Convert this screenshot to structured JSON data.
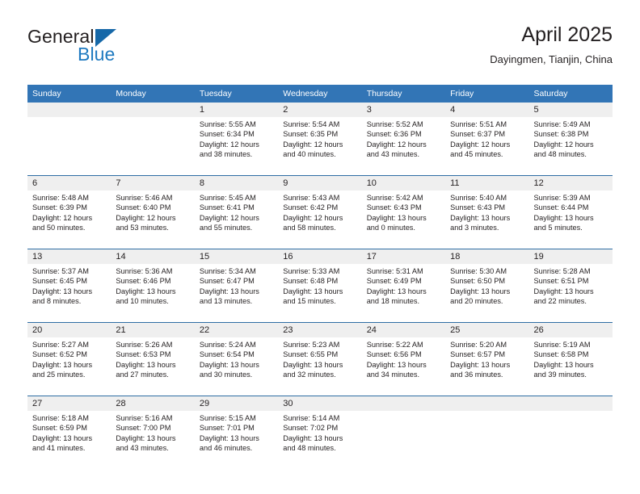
{
  "brand": {
    "name_part1": "General",
    "name_part2": "Blue",
    "triangle_color": "#1668a8",
    "blue_text_color": "#1f7ac0"
  },
  "header": {
    "title": "April 2025",
    "subtitle": "Dayingmen, Tianjin, China"
  },
  "theme": {
    "header_blue": "#3275b6",
    "row_divider_blue": "#2e6da4",
    "daynum_band": "#efefef",
    "text": "#231f20"
  },
  "weekday_headers": [
    "Sunday",
    "Monday",
    "Tuesday",
    "Wednesday",
    "Thursday",
    "Friday",
    "Saturday"
  ],
  "weeks": [
    [
      {
        "empty": true
      },
      {
        "empty": true
      },
      {
        "day": "1",
        "sunrise": "Sunrise: 5:55 AM",
        "sunset": "Sunset: 6:34 PM",
        "daylight_line1": "Daylight: 12 hours",
        "daylight_line2": "and 38 minutes."
      },
      {
        "day": "2",
        "sunrise": "Sunrise: 5:54 AM",
        "sunset": "Sunset: 6:35 PM",
        "daylight_line1": "Daylight: 12 hours",
        "daylight_line2": "and 40 minutes."
      },
      {
        "day": "3",
        "sunrise": "Sunrise: 5:52 AM",
        "sunset": "Sunset: 6:36 PM",
        "daylight_line1": "Daylight: 12 hours",
        "daylight_line2": "and 43 minutes."
      },
      {
        "day": "4",
        "sunrise": "Sunrise: 5:51 AM",
        "sunset": "Sunset: 6:37 PM",
        "daylight_line1": "Daylight: 12 hours",
        "daylight_line2": "and 45 minutes."
      },
      {
        "day": "5",
        "sunrise": "Sunrise: 5:49 AM",
        "sunset": "Sunset: 6:38 PM",
        "daylight_line1": "Daylight: 12 hours",
        "daylight_line2": "and 48 minutes."
      }
    ],
    [
      {
        "day": "6",
        "sunrise": "Sunrise: 5:48 AM",
        "sunset": "Sunset: 6:39 PM",
        "daylight_line1": "Daylight: 12 hours",
        "daylight_line2": "and 50 minutes."
      },
      {
        "day": "7",
        "sunrise": "Sunrise: 5:46 AM",
        "sunset": "Sunset: 6:40 PM",
        "daylight_line1": "Daylight: 12 hours",
        "daylight_line2": "and 53 minutes."
      },
      {
        "day": "8",
        "sunrise": "Sunrise: 5:45 AM",
        "sunset": "Sunset: 6:41 PM",
        "daylight_line1": "Daylight: 12 hours",
        "daylight_line2": "and 55 minutes."
      },
      {
        "day": "9",
        "sunrise": "Sunrise: 5:43 AM",
        "sunset": "Sunset: 6:42 PM",
        "daylight_line1": "Daylight: 12 hours",
        "daylight_line2": "and 58 minutes."
      },
      {
        "day": "10",
        "sunrise": "Sunrise: 5:42 AM",
        "sunset": "Sunset: 6:43 PM",
        "daylight_line1": "Daylight: 13 hours",
        "daylight_line2": "and 0 minutes."
      },
      {
        "day": "11",
        "sunrise": "Sunrise: 5:40 AM",
        "sunset": "Sunset: 6:43 PM",
        "daylight_line1": "Daylight: 13 hours",
        "daylight_line2": "and 3 minutes."
      },
      {
        "day": "12",
        "sunrise": "Sunrise: 5:39 AM",
        "sunset": "Sunset: 6:44 PM",
        "daylight_line1": "Daylight: 13 hours",
        "daylight_line2": "and 5 minutes."
      }
    ],
    [
      {
        "day": "13",
        "sunrise": "Sunrise: 5:37 AM",
        "sunset": "Sunset: 6:45 PM",
        "daylight_line1": "Daylight: 13 hours",
        "daylight_line2": "and 8 minutes."
      },
      {
        "day": "14",
        "sunrise": "Sunrise: 5:36 AM",
        "sunset": "Sunset: 6:46 PM",
        "daylight_line1": "Daylight: 13 hours",
        "daylight_line2": "and 10 minutes."
      },
      {
        "day": "15",
        "sunrise": "Sunrise: 5:34 AM",
        "sunset": "Sunset: 6:47 PM",
        "daylight_line1": "Daylight: 13 hours",
        "daylight_line2": "and 13 minutes."
      },
      {
        "day": "16",
        "sunrise": "Sunrise: 5:33 AM",
        "sunset": "Sunset: 6:48 PM",
        "daylight_line1": "Daylight: 13 hours",
        "daylight_line2": "and 15 minutes."
      },
      {
        "day": "17",
        "sunrise": "Sunrise: 5:31 AM",
        "sunset": "Sunset: 6:49 PM",
        "daylight_line1": "Daylight: 13 hours",
        "daylight_line2": "and 18 minutes."
      },
      {
        "day": "18",
        "sunrise": "Sunrise: 5:30 AM",
        "sunset": "Sunset: 6:50 PM",
        "daylight_line1": "Daylight: 13 hours",
        "daylight_line2": "and 20 minutes."
      },
      {
        "day": "19",
        "sunrise": "Sunrise: 5:28 AM",
        "sunset": "Sunset: 6:51 PM",
        "daylight_line1": "Daylight: 13 hours",
        "daylight_line2": "and 22 minutes."
      }
    ],
    [
      {
        "day": "20",
        "sunrise": "Sunrise: 5:27 AM",
        "sunset": "Sunset: 6:52 PM",
        "daylight_line1": "Daylight: 13 hours",
        "daylight_line2": "and 25 minutes."
      },
      {
        "day": "21",
        "sunrise": "Sunrise: 5:26 AM",
        "sunset": "Sunset: 6:53 PM",
        "daylight_line1": "Daylight: 13 hours",
        "daylight_line2": "and 27 minutes."
      },
      {
        "day": "22",
        "sunrise": "Sunrise: 5:24 AM",
        "sunset": "Sunset: 6:54 PM",
        "daylight_line1": "Daylight: 13 hours",
        "daylight_line2": "and 30 minutes."
      },
      {
        "day": "23",
        "sunrise": "Sunrise: 5:23 AM",
        "sunset": "Sunset: 6:55 PM",
        "daylight_line1": "Daylight: 13 hours",
        "daylight_line2": "and 32 minutes."
      },
      {
        "day": "24",
        "sunrise": "Sunrise: 5:22 AM",
        "sunset": "Sunset: 6:56 PM",
        "daylight_line1": "Daylight: 13 hours",
        "daylight_line2": "and 34 minutes."
      },
      {
        "day": "25",
        "sunrise": "Sunrise: 5:20 AM",
        "sunset": "Sunset: 6:57 PM",
        "daylight_line1": "Daylight: 13 hours",
        "daylight_line2": "and 36 minutes."
      },
      {
        "day": "26",
        "sunrise": "Sunrise: 5:19 AM",
        "sunset": "Sunset: 6:58 PM",
        "daylight_line1": "Daylight: 13 hours",
        "daylight_line2": "and 39 minutes."
      }
    ],
    [
      {
        "day": "27",
        "sunrise": "Sunrise: 5:18 AM",
        "sunset": "Sunset: 6:59 PM",
        "daylight_line1": "Daylight: 13 hours",
        "daylight_line2": "and 41 minutes."
      },
      {
        "day": "28",
        "sunrise": "Sunrise: 5:16 AM",
        "sunset": "Sunset: 7:00 PM",
        "daylight_line1": "Daylight: 13 hours",
        "daylight_line2": "and 43 minutes."
      },
      {
        "day": "29",
        "sunrise": "Sunrise: 5:15 AM",
        "sunset": "Sunset: 7:01 PM",
        "daylight_line1": "Daylight: 13 hours",
        "daylight_line2": "and 46 minutes."
      },
      {
        "day": "30",
        "sunrise": "Sunrise: 5:14 AM",
        "sunset": "Sunset: 7:02 PM",
        "daylight_line1": "Daylight: 13 hours",
        "daylight_line2": "and 48 minutes."
      },
      {
        "empty": true
      },
      {
        "empty": true
      },
      {
        "empty": true
      }
    ]
  ]
}
